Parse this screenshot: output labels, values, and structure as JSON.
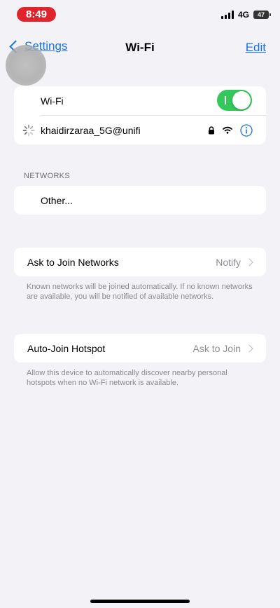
{
  "status_bar": {
    "time": "8:49",
    "network_type": "4G",
    "battery_level": "47"
  },
  "nav": {
    "back_label": "Settings",
    "title": "Wi-Fi",
    "edit_label": "Edit"
  },
  "wifi": {
    "toggle_label": "Wi-Fi",
    "toggle_on": true,
    "connected_network": "khaidirzaraa_5G@unifi"
  },
  "networks": {
    "header": "NETWORKS",
    "other_label": "Other..."
  },
  "ask_to_join": {
    "label": "Ask to Join Networks",
    "value": "Notify",
    "footnote": "Known networks will be joined automatically. If no known networks are available, you will be notified of available networks."
  },
  "auto_join": {
    "label": "Auto-Join Hotspot",
    "value": "Ask to Join",
    "footnote": "Allow this device to automatically discover nearby personal hotspots when no Wi-Fi network is available."
  },
  "colors": {
    "accent": "#1a73e8",
    "toggle_on": "#34c759",
    "time_pill": "#e0242c",
    "background": "#f2f2f7"
  }
}
